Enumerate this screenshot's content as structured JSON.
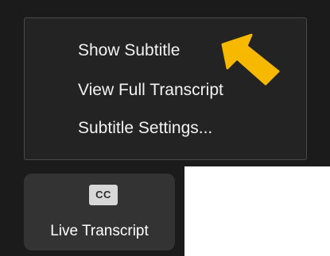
{
  "menu": {
    "items": [
      {
        "label": "Show Subtitle"
      },
      {
        "label": "View Full Transcript"
      },
      {
        "label": "Subtitle Settings..."
      }
    ]
  },
  "pointer": {
    "icon": "arrow-pointer-icon",
    "color": "#f7b800"
  },
  "toolbar": {
    "live_transcript": {
      "badge": "CC",
      "label": "Live Transcript"
    }
  },
  "colors": {
    "background": "#1b1b1b",
    "menu_background": "#232323",
    "button_background": "#333333",
    "text": "#f2f2f2"
  }
}
